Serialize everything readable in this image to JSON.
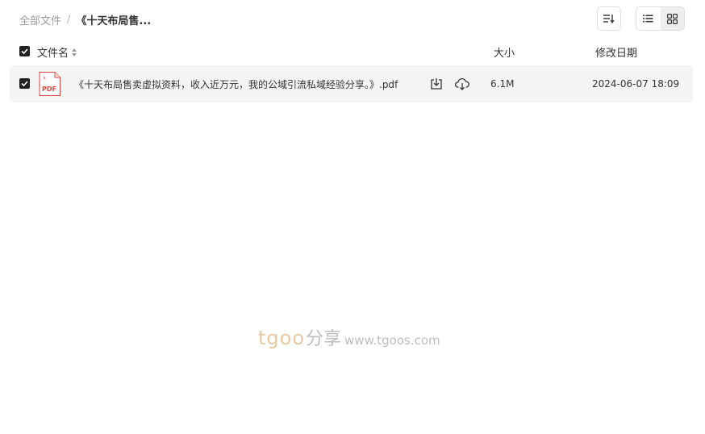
{
  "breadcrumb": {
    "root": "全部文件",
    "separator": "/",
    "current": "《十天布局售..."
  },
  "toolbar": {
    "sort_icon": "sort-lines-icon",
    "view_list_icon": "list-view-icon",
    "view_grid_icon": "grid-view-icon",
    "active_view": "list"
  },
  "table": {
    "columns": {
      "name": "文件名",
      "size": "大小",
      "date": "修改日期"
    },
    "header_checked": true,
    "rows": [
      {
        "checked": true,
        "icon": "pdf-icon",
        "icon_label": "PDF",
        "name": "《十天布局售卖虚拟资料，收入近万元，我的公域引流私域经验分享。》.pdf",
        "size": "6.1M",
        "date": "2024-06-07 18:09",
        "actions": [
          "download-icon",
          "cloud-save-icon"
        ]
      }
    ]
  },
  "watermark": {
    "brand": "tgoo",
    "cn": "分享",
    "url": "www.tgoos.com"
  },
  "colors": {
    "pdf_red": "#e0453a",
    "row_bg": "#f4f4f4",
    "checkbox": "#222222",
    "watermark_brand": "#e6c9a0"
  }
}
